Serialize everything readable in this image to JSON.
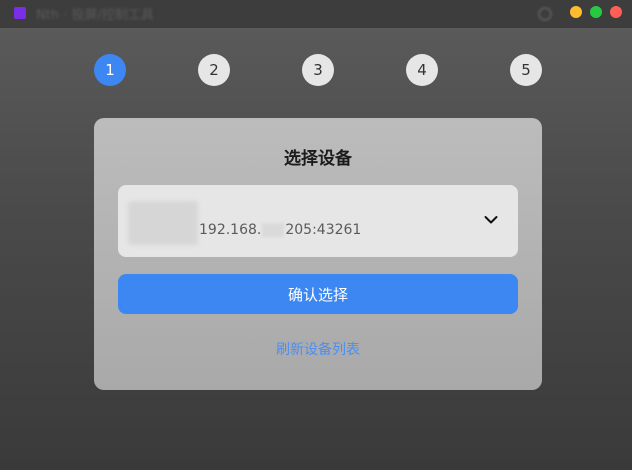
{
  "titlebar": {
    "app_name": "Nth · 投屏/控制工具"
  },
  "steps": [
    "1",
    "2",
    "3",
    "4",
    "5"
  ],
  "card": {
    "title": "选择设备",
    "device": {
      "addr_prefix": "192.168.",
      "addr_suffix": "205:43261"
    },
    "confirm_label": "确认选择",
    "refresh_label": "刷新设备列表"
  },
  "colors": {
    "accent": "#3c87f2",
    "link": "#4a8ef5"
  }
}
